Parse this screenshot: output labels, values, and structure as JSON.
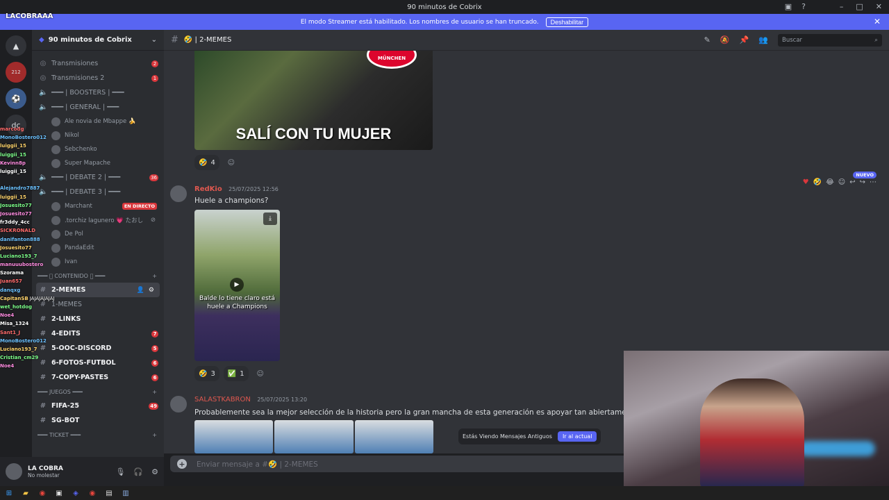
{
  "window": {
    "title": "90 minutos de Cobrix"
  },
  "banner": {
    "text": "El modo Streamer está habilitado. Los nombres de usuario se han truncado.",
    "button": "Deshabilitar"
  },
  "stream": {
    "tag": "LACOBRAAA"
  },
  "guilds": {
    "mention_count": "212",
    "dc_label": "dc"
  },
  "server": {
    "name": "90 minutos de Cobrix"
  },
  "channels": {
    "items": [
      {
        "name": "Transmisiones",
        "badge": "2",
        "icon": "broadcast-icon"
      },
      {
        "name": "Transmisiones 2",
        "badge": "1",
        "icon": "broadcast-icon"
      },
      {
        "name": "━━━ | BOOSTERS | ━━━",
        "badge": "",
        "icon": "speaker-icon"
      },
      {
        "name": "━━━ | GENERAL | ━━━",
        "badge": "",
        "icon": "speaker-icon"
      }
    ],
    "voice_users_general": [
      "Ale novia de Mbappe 🍌",
      "Nikol",
      "Sebchenko",
      "Super Mapache"
    ],
    "debate2": {
      "name": "━━━ | DEBATE 2 | ━━━",
      "badge": "36"
    },
    "debate3": {
      "name": "━━━ | DEBATE 3 | ━━━"
    },
    "voice_users_debate3": [
      {
        "name": "Marchant",
        "live": "EN DIRECTO"
      },
      {
        "name": ".torchiz lagunero 💗 たおし",
        "live": ""
      },
      {
        "name": "De Pol",
        "live": ""
      },
      {
        "name": "PandaEdit",
        "live": ""
      },
      {
        "name": "Ivan",
        "live": ""
      }
    ],
    "category_contenido": "━━━ 🏽 CONTENIDO 🏽 ━━━",
    "text_channels": [
      {
        "name": "2-MEMES",
        "badge": "",
        "active": true
      },
      {
        "name": "1-MEMES",
        "badge": "",
        "active": false
      },
      {
        "name": "2-LINKS",
        "badge": "",
        "active": false
      },
      {
        "name": "4-EDITS",
        "badge": "7",
        "active": false
      },
      {
        "name": "5-OOC-DISCORD",
        "badge": "5",
        "active": false
      },
      {
        "name": "6-FOTOS-FUTBOL",
        "badge": "6",
        "active": false
      },
      {
        "name": "7-COPY-PASTES",
        "badge": "6",
        "active": false
      }
    ],
    "category_juegos": "━━━ JUEGOS ━━━",
    "game_channels": [
      {
        "name": "FIFA-25",
        "badge": "49"
      },
      {
        "name": "SG-BOT",
        "badge": ""
      }
    ],
    "category_ticket": "━━━ TICKET ━━━"
  },
  "user": {
    "name": "LA COBRA",
    "status": "No molestar"
  },
  "overlay_chat": [
    {
      "name": "marcodg",
      "text": ""
    },
    {
      "name": "MonoBostero012",
      "text": ""
    },
    {
      "name": "luiggii_15",
      "text": ""
    },
    {
      "name": "luiggii_15",
      "text": ""
    },
    {
      "name": "Kevinn8p",
      "text": ""
    },
    {
      "name": "luiggii_15",
      "text": ""
    },
    {
      "name": "",
      "text": ""
    },
    {
      "name": "Alejandro7887",
      "text": ""
    },
    {
      "name": "luiggii_15",
      "text": ""
    },
    {
      "name": "Josuesito77",
      "text": ""
    },
    {
      "name": "Josuesito77",
      "text": ""
    },
    {
      "name": "fr3ddy_4cc",
      "text": ""
    },
    {
      "name": "SICKRONALD",
      "text": ""
    },
    {
      "name": "danifanton888",
      "text": ""
    },
    {
      "name": "Josuesito77",
      "text": ""
    },
    {
      "name": "Luciano193_7",
      "text": ""
    },
    {
      "name": "manuuubostero",
      "text": ""
    },
    {
      "name": "Szorama",
      "text": ""
    },
    {
      "name": "Juan657",
      "text": ""
    },
    {
      "name": "danqxg",
      "text": ""
    },
    {
      "name": "CapitanSB",
      "text": "JAJAJAJAJAJ"
    },
    {
      "name": "wet_hotdog",
      "text": ""
    },
    {
      "name": "Noe4",
      "text": ""
    },
    {
      "name": "Misa_1324",
      "text": ""
    },
    {
      "name": "Sant1_J",
      "text": ""
    },
    {
      "name": "MonoBostero012",
      "text": ""
    },
    {
      "name": "Luciano193_7",
      "text": ""
    },
    {
      "name": "Cristian_cm29",
      "text": ""
    },
    {
      "name": "Noe4",
      "text": ""
    }
  ],
  "chat": {
    "channel": "🤣 | 2-MEMES",
    "search_placeholder": "Buscar",
    "meme_caption": "SALÍ CON TU MUJER",
    "meme_logo": "MÜNCHEN",
    "meme_reactions": [
      {
        "emoji": "🤣",
        "count": "4"
      }
    ],
    "messages": [
      {
        "author": "RedKio",
        "author_color": "#e0584f",
        "time": "25/07/2025 12:56",
        "text": "Huele a champions?",
        "video_caption": "Balde lo tiene claro está huele a Champions",
        "reactions": [
          {
            "emoji": "🤣",
            "count": "3"
          },
          {
            "emoji": "✅",
            "count": "1"
          }
        ]
      },
      {
        "author": "SALASTKABRON",
        "author_color": "#e0584f",
        "time": "25/07/2025 13:20",
        "text": "Probablemente sea la mejor selección de la historia pero la gran mancha de esta generación es apoyar tan abiertame"
      }
    ],
    "new_badge": "NUEVO",
    "old_messages": {
      "text": "Estás Viendo Mensajes Antiguos",
      "button": "Ir al actual"
    },
    "composer_placeholder": "Enviar mensaje a #🤣 | 2-MEMES"
  },
  "colors": {
    "accent": "#5865f2",
    "danger": "#da373c",
    "bg": "#313338"
  }
}
